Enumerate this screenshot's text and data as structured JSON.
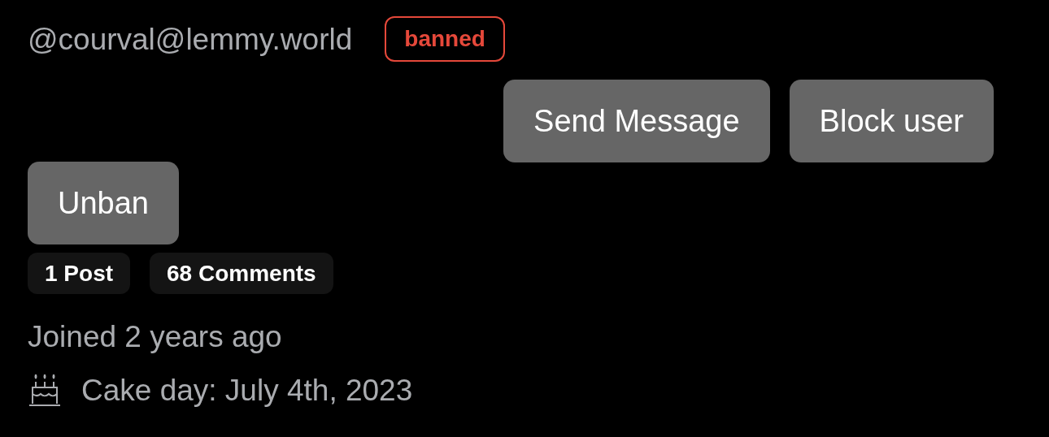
{
  "handle": "@courval@lemmy.world",
  "badge": {
    "label": "banned",
    "color": "#e5483a"
  },
  "actions": [
    {
      "label": "Send Message"
    },
    {
      "label": "Block user"
    }
  ],
  "mod_actions": [
    {
      "label": "Unban"
    }
  ],
  "counts": [
    {
      "label": "1 Post"
    },
    {
      "label": "68 Comments"
    }
  ],
  "joined": "Joined 2 years ago",
  "cake_day": "Cake day: July 4th, 2023"
}
